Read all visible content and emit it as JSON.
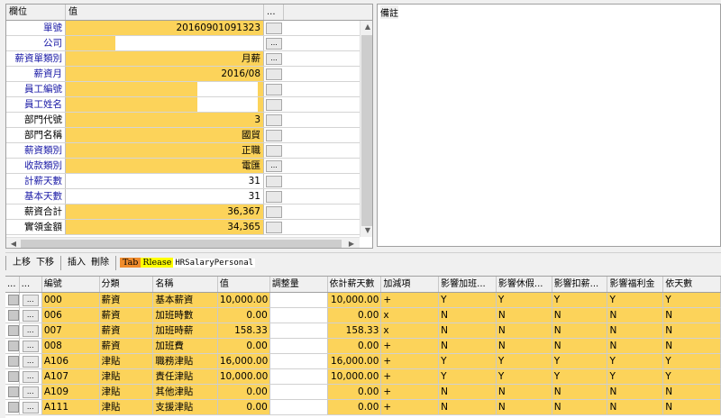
{
  "property_grid": {
    "header": {
      "field": "欄位",
      "value": "值",
      "extra": "..."
    },
    "rows": [
      {
        "label": "單號",
        "value": "20160901091323",
        "blue": true,
        "bg": "yellow",
        "button": ""
      },
      {
        "label": "公司",
        "value": "",
        "blue": true,
        "bg": "split-company",
        "button": "..."
      },
      {
        "label": "薪資單類別",
        "value": "月薪",
        "blue": true,
        "bg": "yellow",
        "button": "..."
      },
      {
        "label": "薪資月",
        "value": "2016/08",
        "blue": true,
        "bg": "yellow",
        "button": ""
      },
      {
        "label": "員工編號",
        "value": "",
        "blue": true,
        "bg": "split-emp",
        "button": ""
      },
      {
        "label": "員工姓名",
        "value": "",
        "blue": true,
        "bg": "split-emp",
        "button": ""
      },
      {
        "label": "部門代號",
        "value": "3",
        "blue": false,
        "bg": "yellow",
        "button": ""
      },
      {
        "label": "部門名稱",
        "value": "國貿",
        "blue": false,
        "bg": "yellow",
        "button": ""
      },
      {
        "label": "薪資類別",
        "value": "正職",
        "blue": true,
        "bg": "yellow",
        "button": ""
      },
      {
        "label": "收款類別",
        "value": "電匯",
        "blue": true,
        "bg": "yellow",
        "button": "..."
      },
      {
        "label": "計薪天數",
        "value": "31",
        "blue": true,
        "bg": "white",
        "button": ""
      },
      {
        "label": "基本天數",
        "value": "31",
        "blue": true,
        "bg": "white",
        "button": ""
      },
      {
        "label": "薪資合計",
        "value": "36,367",
        "blue": false,
        "bg": "yellow",
        "button": ""
      },
      {
        "label": "實領金額",
        "value": "34,365",
        "blue": false,
        "bg": "yellow",
        "button": ""
      }
    ]
  },
  "memo": {
    "label": "備註"
  },
  "toolbar": {
    "up": "上移",
    "down": "下移",
    "insert": "插入",
    "delete": "刪除",
    "tag_tab": "Tab",
    "tag_release": "Rlease",
    "tag_name": "HRSalaryPersonal"
  },
  "detail_grid": {
    "columns": [
      "...",
      "...",
      "編號",
      "分類",
      "名稱",
      "值",
      "調整量",
      "依計薪天數",
      "加減項",
      "影響加班...",
      "影響休假...",
      "影響扣薪...",
      "影響福利金",
      "依天數"
    ],
    "rows": [
      [
        "000",
        "薪資",
        "基本薪資",
        "10,000.00",
        "",
        "10,000.00",
        "+",
        "Y",
        "Y",
        "Y",
        "Y",
        "Y"
      ],
      [
        "006",
        "薪資",
        "加班時數",
        "0.00",
        "",
        "0.00",
        "x",
        "N",
        "N",
        "N",
        "N",
        "N"
      ],
      [
        "007",
        "薪資",
        "加班時薪",
        "158.33",
        "",
        "158.33",
        "x",
        "N",
        "N",
        "N",
        "N",
        "N"
      ],
      [
        "008",
        "薪資",
        "加班費",
        "0.00",
        "",
        "0.00",
        "+",
        "N",
        "N",
        "N",
        "N",
        "N"
      ],
      [
        "A106",
        "津貼",
        "職務津貼",
        "16,000.00",
        "",
        "16,000.00",
        "+",
        "Y",
        "Y",
        "Y",
        "Y",
        "Y"
      ],
      [
        "A107",
        "津貼",
        "責任津貼",
        "10,000.00",
        "",
        "10,000.00",
        "+",
        "Y",
        "Y",
        "Y",
        "Y",
        "Y"
      ],
      [
        "A109",
        "津貼",
        "其他津貼",
        "0.00",
        "",
        "0.00",
        "+",
        "N",
        "N",
        "N",
        "N",
        "N"
      ],
      [
        "A111",
        "津貼",
        "支援津貼",
        "0.00",
        "",
        "0.00",
        "+",
        "N",
        "N",
        "N",
        "N",
        "N"
      ]
    ]
  },
  "colors": {
    "highlight": "#fcd35a",
    "label_blue": "#1a1aa6"
  }
}
